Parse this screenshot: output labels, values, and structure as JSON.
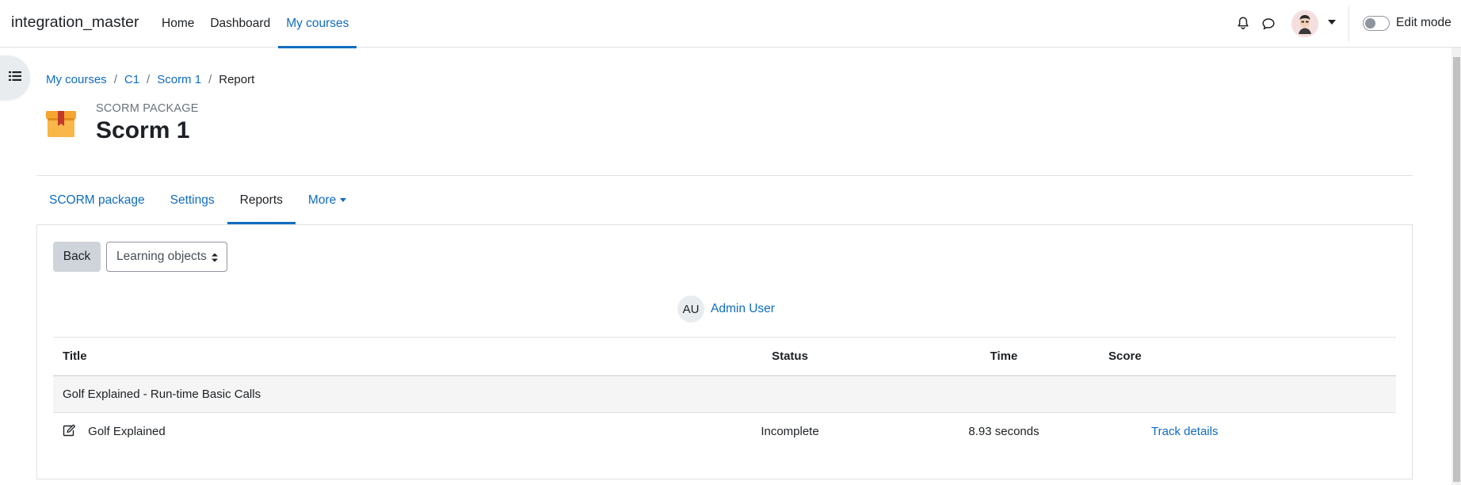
{
  "navbar": {
    "brand": "integration_master",
    "items": [
      {
        "label": "Home"
      },
      {
        "label": "Dashboard"
      },
      {
        "label": "My courses"
      }
    ],
    "edit_mode_label": "Edit mode"
  },
  "breadcrumb": {
    "items": [
      "My courses",
      "C1",
      "Scorm 1"
    ],
    "current": "Report",
    "separator": "/"
  },
  "header": {
    "pretitle": "SCORM PACKAGE",
    "title": "Scorm 1"
  },
  "secondary_nav": {
    "tabs": [
      {
        "label": "SCORM package"
      },
      {
        "label": "Settings"
      },
      {
        "label": "Reports"
      },
      {
        "label": "More"
      }
    ]
  },
  "toolbar": {
    "back_label": "Back",
    "select_value": "Learning objects"
  },
  "user": {
    "initials": "AU",
    "name": "Admin User"
  },
  "table": {
    "headers": {
      "title": "Title",
      "status": "Status",
      "time": "Time",
      "score": "Score"
    },
    "group_title": "Golf Explained - Run-time Basic Calls",
    "rows": [
      {
        "title": "Golf Explained",
        "status": "Incomplete",
        "time": "8.93 seconds",
        "action": "Track details"
      }
    ]
  },
  "colors": {
    "link": "#0f6cbf",
    "text": "#1d2125",
    "border": "#dee2e6",
    "button_secondary": "#ced4da"
  }
}
